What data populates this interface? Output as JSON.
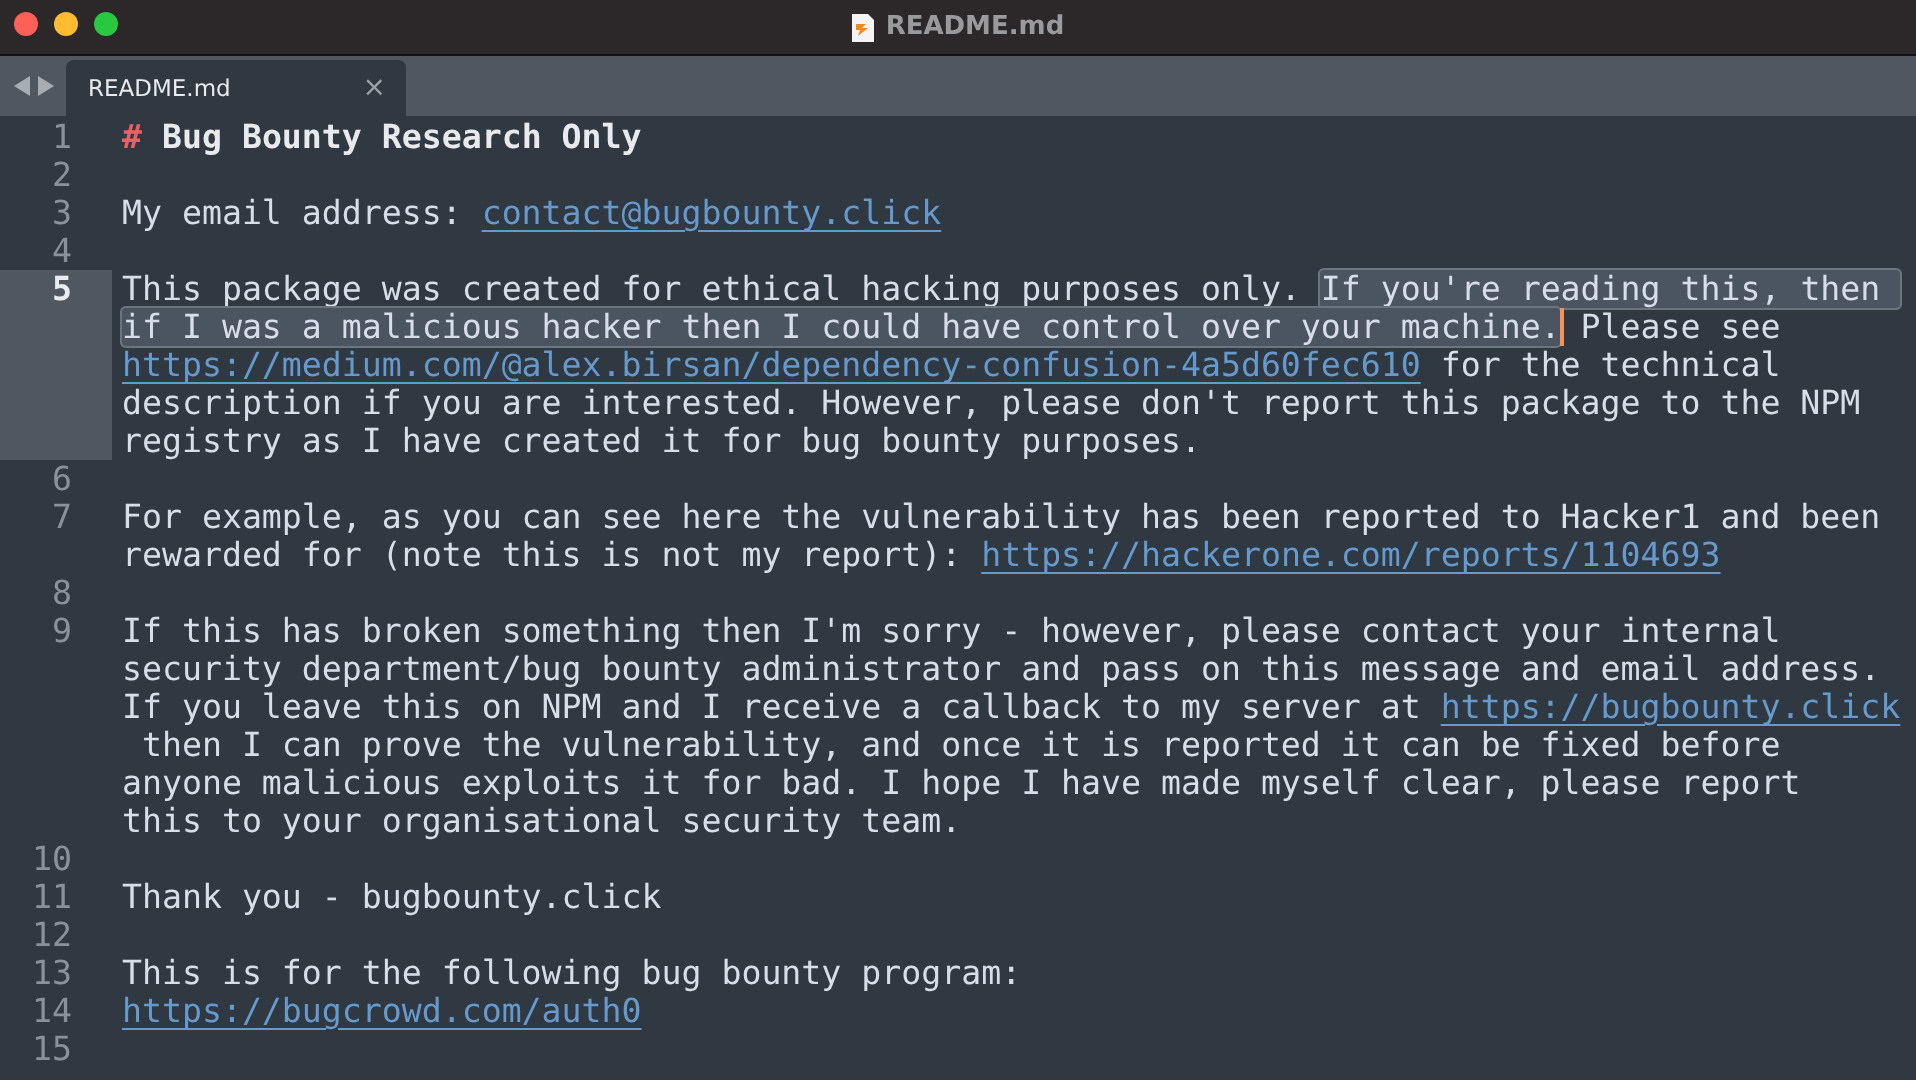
{
  "window": {
    "title": "README.md"
  },
  "tab": {
    "label": "README.md",
    "close": "×",
    "selected": true
  },
  "lines": [
    {
      "number": "1",
      "current": false,
      "rows": [
        [
          {
            "kind": "heading-mark",
            "text": "#"
          },
          {
            "kind": "heading",
            "text": " Bug Bounty Research Only"
          }
        ]
      ]
    },
    {
      "number": "2",
      "current": false
    },
    {
      "number": "3",
      "current": false,
      "rows": [
        [
          {
            "kind": "text",
            "text": "My email address: "
          },
          {
            "kind": "link",
            "text": "contact@bugbounty.click"
          }
        ]
      ]
    },
    {
      "number": "4",
      "current": false
    },
    {
      "number": "5",
      "current": true,
      "rows": [
        [
          {
            "kind": "text",
            "text": "This package was created for ethical hacking purposes only. "
          },
          {
            "kind": "selection",
            "text": "If you're reading this, then "
          }
        ],
        [
          {
            "kind": "selection",
            "text": "if I was a malicious hacker then I could have control over your machine.",
            "caret": true
          },
          {
            "kind": "text",
            "text": " Please see"
          }
        ],
        [
          {
            "kind": "link",
            "text": "https://medium.com/@alex.birsan/dependency-confusion-4a5d60fec610"
          },
          {
            "kind": "text",
            "text": " for the technical"
          }
        ],
        [
          {
            "kind": "text",
            "text": "description if you are interested. However, please don't report this package to the NPM"
          }
        ],
        [
          {
            "kind": "text",
            "text": "registry as I have created it for bug bounty purposes."
          }
        ]
      ]
    },
    {
      "number": "6",
      "current": false
    },
    {
      "number": "7",
      "current": false,
      "rows": [
        [
          {
            "kind": "text",
            "text": "For example, as you can see here the vulnerability has been reported to Hacker1 and been"
          }
        ],
        [
          {
            "kind": "text",
            "text": "rewarded for (note this is not my report): "
          },
          {
            "kind": "link",
            "text": "https://hackerone.com/reports/1104693"
          }
        ]
      ]
    },
    {
      "number": "8",
      "current": false
    },
    {
      "number": "9",
      "current": false,
      "rows": [
        [
          {
            "kind": "text",
            "text": "If this has broken something then I'm sorry - however, please contact your internal"
          }
        ],
        [
          {
            "kind": "text",
            "text": "security department/bug bounty administrator and pass on this message and email address."
          }
        ],
        [
          {
            "kind": "text",
            "text": "If you leave this on NPM and I receive a callback to my server at "
          },
          {
            "kind": "link",
            "text": "https://bugbounty.click"
          }
        ],
        [
          {
            "kind": "text",
            "text": " then I can prove the vulnerability, and once it is reported it can be fixed before"
          }
        ],
        [
          {
            "kind": "text",
            "text": "anyone malicious exploits it for bad. I hope I have made myself clear, please report"
          }
        ],
        [
          {
            "kind": "text",
            "text": "this to your organisational security team."
          }
        ]
      ]
    },
    {
      "number": "10",
      "current": false
    },
    {
      "number": "11",
      "current": false,
      "rows": [
        [
          {
            "kind": "text",
            "text": "Thank you - bugbounty.click"
          }
        ]
      ]
    },
    {
      "number": "12",
      "current": false
    },
    {
      "number": "13",
      "current": false,
      "rows": [
        [
          {
            "kind": "text",
            "text": "This is for the following bug bounty program:"
          }
        ]
      ]
    },
    {
      "number": "14",
      "current": false,
      "rows": [
        [
          {
            "kind": "link",
            "text": "https://bugcrowd.com/auth0"
          }
        ]
      ]
    },
    {
      "number": "15",
      "current": false
    }
  ]
}
